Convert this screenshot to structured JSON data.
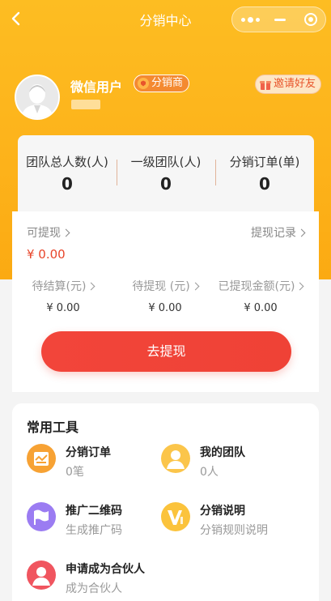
{
  "nav": {
    "title": "分销中心",
    "back_icon": "chevron-left-icon",
    "more_icon": "more-dots-icon",
    "minimize_icon": "minimize-icon",
    "close_icon": "target-close-icon"
  },
  "profile": {
    "name": "微信用户",
    "role_badge": "分销商",
    "invite_label": "邀请好友",
    "avatar_icon": "default-avatar-icon"
  },
  "stats": [
    {
      "label": "团队总人数(人)",
      "value": "0"
    },
    {
      "label": "一级团队(人)",
      "value": "0"
    },
    {
      "label": "分销订单(单)",
      "value": "0"
    }
  ],
  "wallet": {
    "withdrawable_label": "可提现",
    "history_label": "提现记录",
    "balance": "¥ 0.00",
    "sub_stats": [
      {
        "label": "待结算(元)",
        "value": "¥ 0.00"
      },
      {
        "label": "待提现 (元)",
        "value": "¥ 0.00"
      },
      {
        "label": "已提现金额(元)",
        "value": "¥ 0.00"
      }
    ],
    "withdraw_button": "去提现"
  },
  "tools": {
    "title": "常用工具",
    "items": [
      {
        "name": "分销订单",
        "desc": "0笔",
        "icon": "order-icon",
        "color": "#f7a234"
      },
      {
        "name": "我的团队",
        "desc": "0人",
        "icon": "team-icon",
        "color": "#fbc54a"
      },
      {
        "name": "推广二维码",
        "desc": "生成推广码",
        "icon": "flag-icon",
        "color": "#9b7cf2"
      },
      {
        "name": "分销说明",
        "desc": "分销规则说明",
        "icon": "vip-icon",
        "color": "#fbc33c"
      },
      {
        "name": "申请成为合伙人",
        "desc": "成为合伙人",
        "icon": "partner-icon",
        "color": "#f0555f"
      }
    ]
  },
  "colors": {
    "brand_yellow": "#fdb21a",
    "accent_red": "#f2453a",
    "page_bg": "#f4f4f4"
  }
}
